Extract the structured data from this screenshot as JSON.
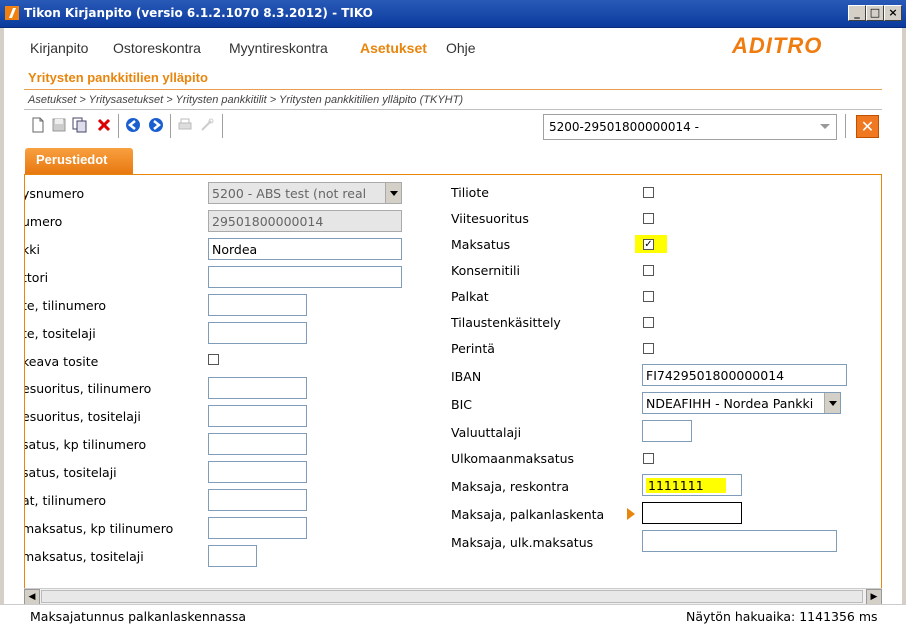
{
  "window": {
    "title": "Tikon Kirjanpito (versio 6.1.2.1070 8.3.2012) - TIKO",
    "buttons": [
      "_",
      "□",
      "×"
    ]
  },
  "menu": [
    "Kirjanpito",
    "Ostoreskontra",
    "Myyntireskontra",
    "Asetukset",
    "Ohje"
  ],
  "logo": "ADITRO",
  "page_title": "Yritysten pankkitilien ylläpito",
  "breadcrumb": "Asetukset > Yritysasetukset > Yritysten pankkitilit > Yritysten pankkitilien ylläpito  (TKYHT)",
  "record_selector": "5200-29501800000014 -",
  "tab": "Perustiedot",
  "left_fields": [
    {
      "label": "ysnumero",
      "value": "5200 - ABS test (not real"
    },
    {
      "label": "umero",
      "value": "29501800000014"
    },
    {
      "label": "kki",
      "value": "Nordea"
    },
    {
      "label": "ttori",
      "value": ""
    },
    {
      "label": "te, tilinumero",
      "value": ""
    },
    {
      "label": "te, tositelaji",
      "value": ""
    },
    {
      "label": "keava tosite",
      "value": ""
    },
    {
      "label": "esuoritus, tilinumero",
      "value": ""
    },
    {
      "label": "esuoritus, tositelaji",
      "value": ""
    },
    {
      "label": "satus, kp tilinumero",
      "value": ""
    },
    {
      "label": "satus, tositelaji",
      "value": ""
    },
    {
      "label": "at, tilinumero",
      "value": ""
    },
    {
      "label": "maksatus, kp tilinumero",
      "value": ""
    },
    {
      "label": "maksatus, tositelaji",
      "value": ""
    }
  ],
  "right_fields": [
    {
      "label": "Tiliote",
      "checked": false
    },
    {
      "label": "Viitesuoritus",
      "checked": false
    },
    {
      "label": "Maksatus",
      "checked": true
    },
    {
      "label": "Konsernitili",
      "checked": false
    },
    {
      "label": "Palkat",
      "checked": false
    },
    {
      "label": "Tilaustenkäsittely",
      "checked": false
    },
    {
      "label": "Perintä",
      "checked": false
    },
    {
      "label": "IBAN",
      "value": "FI7429501800000014"
    },
    {
      "label": "BIC",
      "value": "NDEAFIHH - Nordea Pankki"
    },
    {
      "label": "Valuuttalaji",
      "value": ""
    },
    {
      "label": "Ulkomaanmaksatus",
      "checked": false
    },
    {
      "label": "Maksaja, reskontra",
      "value": "1111111"
    },
    {
      "label": "Maksaja, palkanlaskenta",
      "value": ""
    },
    {
      "label": "Maksaja, ulk.maksatus",
      "value": ""
    }
  ],
  "status": {
    "left": "Maksajatunnus palkanlaskennassa",
    "right": "Näytön hakuaika: 1141356 ms"
  },
  "colors": {
    "accent": "#e8850c",
    "title_bar": "#0a3a9c",
    "highlight": "#ffff00"
  }
}
